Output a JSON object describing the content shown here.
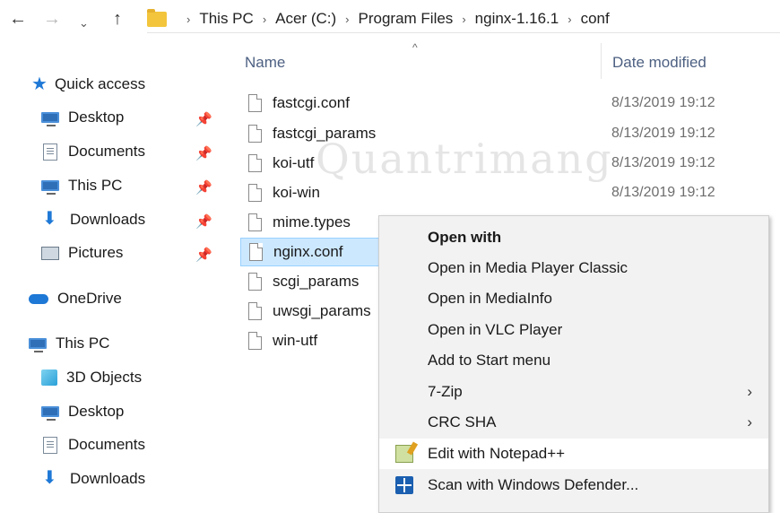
{
  "address_bar": {
    "breadcrumbs": [
      "This PC",
      "Acer (C:)",
      "Program Files",
      "nginx-1.16.1",
      "conf"
    ]
  },
  "sidebar": {
    "quick_access": "Quick access",
    "items": [
      {
        "label": "Desktop",
        "icon": "desktop-icon",
        "pinned": true
      },
      {
        "label": "Documents",
        "icon": "documents-icon",
        "pinned": true
      },
      {
        "label": "This PC",
        "icon": "this-pc-icon",
        "pinned": true
      },
      {
        "label": "Downloads",
        "icon": "downloads-icon",
        "pinned": true
      },
      {
        "label": "Pictures",
        "icon": "pictures-icon",
        "pinned": true
      }
    ],
    "onedrive": "OneDrive",
    "this_pc": "This PC",
    "this_pc_items": [
      {
        "label": "3D Objects",
        "icon": "3d-objects-icon"
      },
      {
        "label": "Desktop",
        "icon": "desktop-icon"
      },
      {
        "label": "Documents",
        "icon": "documents-icon"
      },
      {
        "label": "Downloads",
        "icon": "downloads-icon"
      }
    ]
  },
  "file_list": {
    "columns": {
      "name": "Name",
      "date": "Date modified"
    },
    "files": [
      {
        "name": "fastcgi.conf",
        "date": "8/13/2019 19:12"
      },
      {
        "name": "fastcgi_params",
        "date": "8/13/2019 19:12"
      },
      {
        "name": "koi-utf",
        "date": "8/13/2019 19:12"
      },
      {
        "name": "koi-win",
        "date": "8/13/2019 19:12"
      },
      {
        "name": "mime.types",
        "date": ""
      },
      {
        "name": "nginx.conf",
        "date": "",
        "selected": true
      },
      {
        "name": "scgi_params",
        "date": ""
      },
      {
        "name": "uwsgi_params",
        "date": ""
      },
      {
        "name": "win-utf",
        "date": ""
      }
    ]
  },
  "watermark": "Quantrimang",
  "context_menu": {
    "items": [
      {
        "label": "Open with",
        "bold": true
      },
      {
        "label": "Open in Media Player Classic"
      },
      {
        "label": "Open in MediaInfo"
      },
      {
        "label": "Open in VLC Player"
      },
      {
        "label": "Add to Start menu"
      },
      {
        "label": "7-Zip",
        "submenu": true
      },
      {
        "label": "CRC SHA",
        "submenu": true
      },
      {
        "label": "Edit with Notepad++",
        "icon": "notepad-plus-plus-icon"
      },
      {
        "label": "Scan with Windows Defender...",
        "icon": "windows-defender-icon"
      }
    ]
  }
}
